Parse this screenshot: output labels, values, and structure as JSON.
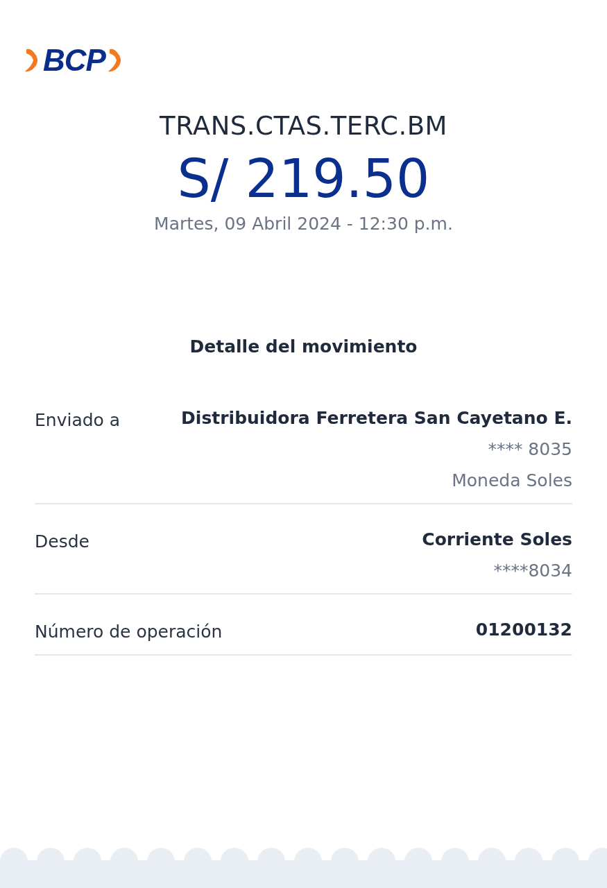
{
  "logo": {
    "text": "BCP"
  },
  "header": {
    "title": "TRANS.CTAS.TERC.BM",
    "amount": "S/ 219.50",
    "datetime": "Martes, 09 Abril 2024 - 12:30 p.m."
  },
  "section_title": "Detalle del movimiento",
  "details": [
    {
      "label": "Enviado a",
      "values": [
        {
          "text": "Distribuidora Ferretera San Cayetano E.",
          "kind": "primary"
        },
        {
          "text": "**** 8035",
          "kind": "secondary"
        },
        {
          "text": "Moneda Soles",
          "kind": "secondary"
        }
      ]
    },
    {
      "label": "Desde",
      "values": [
        {
          "text": "Corriente Soles",
          "kind": "primary"
        },
        {
          "text": "****8034",
          "kind": "secondary"
        }
      ]
    },
    {
      "label": "Número de operación",
      "values": [
        {
          "text": "01200132",
          "kind": "primary"
        }
      ]
    }
  ]
}
